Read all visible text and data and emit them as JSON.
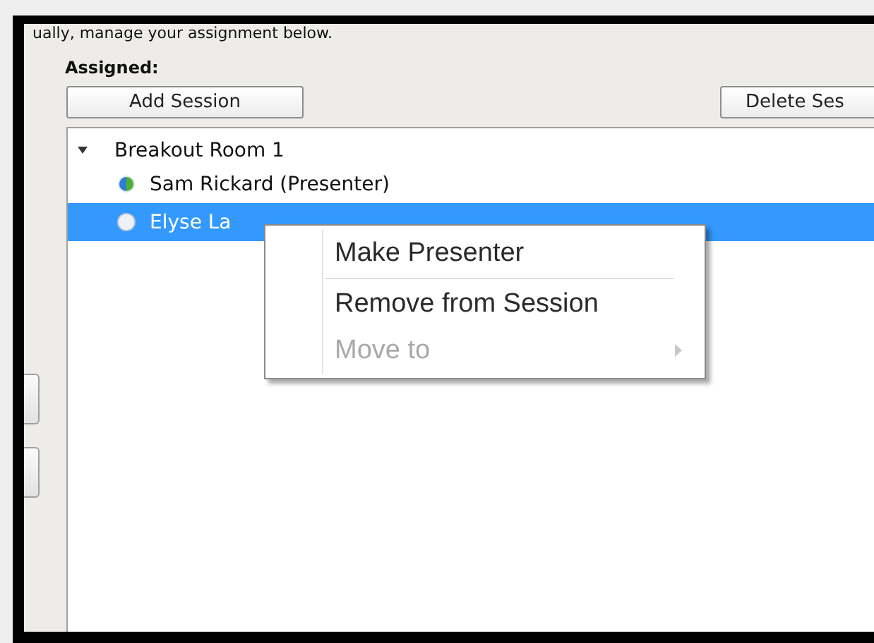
{
  "instruction": "ually, manage your assignment below.",
  "assigned_label": "Assigned:",
  "buttons": [
    {
      "label": "Add Session"
    },
    {
      "label": "Delete Ses"
    }
  ],
  "tree": [
    {
      "label": "Breakout Room 1",
      "expanded": true,
      "children": [
        {
          "label": "Sam Rickard (Presenter)",
          "kind": "presenter",
          "selected": false
        },
        {
          "label": "Elyse La",
          "kind": "attendee",
          "selected": true
        }
      ]
    }
  ],
  "context_menu": {
    "items": [
      {
        "kind": "item",
        "label": "Make Presenter",
        "disabled": false,
        "submenu": false
      },
      {
        "kind": "separator"
      },
      {
        "kind": "item",
        "label": "Remove from Session",
        "disabled": false,
        "submenu": false
      },
      {
        "kind": "item",
        "label": "Move to",
        "disabled": true,
        "submenu": true
      }
    ]
  }
}
